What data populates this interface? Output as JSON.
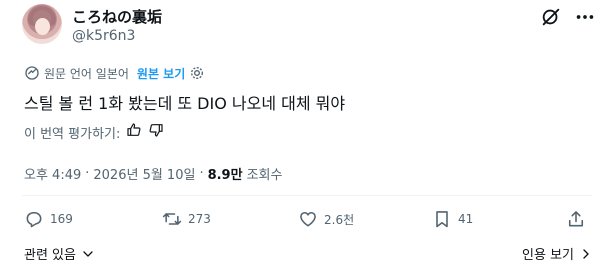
{
  "author": {
    "display_name": "ころねの裏垢",
    "handle": "@k5r6n3"
  },
  "translation_bar": {
    "label": "원문 언어 일본어",
    "toggle_link": "원본 보기"
  },
  "tweet": {
    "text": "스틸 볼 런 1화 봤는데 또 DIO 나오네 대체 뭐야"
  },
  "rate_translation": {
    "label": "이 번역 평가하기:"
  },
  "meta": {
    "time": "오후 4:49",
    "date": "2026년 5월 10일",
    "views_count": "8.9만",
    "views_label": "조회수"
  },
  "actions": {
    "replies": "169",
    "retweets": "273",
    "likes": "2.6천",
    "bookmarks": "41"
  },
  "footer": {
    "related": "관련 있음",
    "quotes": "인용 보기"
  },
  "icons": [
    "grok-icon",
    "more-icon",
    "translate-icon",
    "gear-icon",
    "thumbs-up-icon",
    "thumbs-down-icon",
    "reply-icon",
    "retweet-icon",
    "like-icon",
    "bookmark-icon",
    "share-icon",
    "chevron-down-icon",
    "chevron-right-icon"
  ]
}
